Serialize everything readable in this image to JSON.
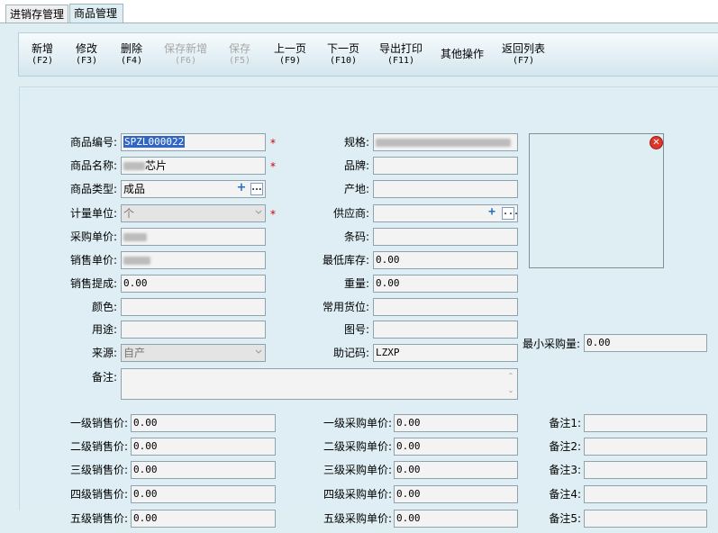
{
  "tabs": [
    {
      "label": "进销存管理"
    },
    {
      "label": "商品管理"
    }
  ],
  "toolbar": {
    "new": {
      "label": "新增",
      "key": "(F2)"
    },
    "edit": {
      "label": "修改",
      "key": "(F3)"
    },
    "delete": {
      "label": "删除",
      "key": "(F4)"
    },
    "save_new": {
      "label": "保存新增",
      "key": "(F6)"
    },
    "save": {
      "label": "保存",
      "key": "(F5)"
    },
    "prev": {
      "label": "上一页",
      "key": "(F9)"
    },
    "next": {
      "label": "下一页",
      "key": "(F10)"
    },
    "export": {
      "label": "导出打印",
      "key": "(F11)"
    },
    "other": {
      "label": "其他操作"
    },
    "back": {
      "label": "返回列表",
      "key": "(F7)"
    }
  },
  "form": {
    "code": {
      "label": "商品编号:",
      "value": "SPZL000022"
    },
    "name": {
      "label": "商品名称:",
      "value": "芯片"
    },
    "type": {
      "label": "商品类型:",
      "value": "成品"
    },
    "unit": {
      "label": "计量单位:",
      "value": "个"
    },
    "purchase_price": {
      "label": "采购单价:"
    },
    "sale_price": {
      "label": "销售单价:"
    },
    "commission": {
      "label": "销售提成:",
      "value": "0.00"
    },
    "color": {
      "label": "颜色:"
    },
    "usage": {
      "label": "用途:"
    },
    "source": {
      "label": "来源:",
      "value": "自产"
    },
    "remark": {
      "label": "备注:"
    },
    "spec": {
      "label": "规格:"
    },
    "brand": {
      "label": "品牌:"
    },
    "origin": {
      "label": "产地:"
    },
    "supplier": {
      "label": "供应商:"
    },
    "barcode": {
      "label": "条码:"
    },
    "min_stock": {
      "label": "最低库存:",
      "value": "0.00"
    },
    "weight": {
      "label": "重量:",
      "value": "0.00"
    },
    "location": {
      "label": "常用货位:"
    },
    "drawing": {
      "label": "图号:"
    },
    "mnemonic": {
      "label": "助记码:",
      "value": "LZXP"
    },
    "min_purchase": {
      "label": "最小采购量:",
      "value": "0.00"
    }
  },
  "levels": [
    {
      "sale_label": "一级销售价:",
      "sale": "0.00",
      "buy_label": "一级采购单价:",
      "buy": "0.00",
      "note_label": "备注1:"
    },
    {
      "sale_label": "二级销售价:",
      "sale": "0.00",
      "buy_label": "二级采购单价:",
      "buy": "0.00",
      "note_label": "备注2:"
    },
    {
      "sale_label": "三级销售价:",
      "sale": "0.00",
      "buy_label": "三级采购单价:",
      "buy": "0.00",
      "note_label": "备注3:"
    },
    {
      "sale_label": "四级销售价:",
      "sale": "0.00",
      "buy_label": "四级采购单价:",
      "buy": "0.00",
      "note_label": "备注4:"
    },
    {
      "sale_label": "五级销售价:",
      "sale": "0.00",
      "buy_label": "五级采购单价:",
      "buy": "0.00",
      "note_label": "备注5:"
    }
  ],
  "required_mark": "*",
  "icons": {
    "add": "plus-icon",
    "browse": "ellipsis-icon",
    "delete_photo": "delete-icon",
    "dropdown": "chevron-down-icon"
  },
  "colors": {
    "accent": "#3166c5",
    "required": "#d00000",
    "delete": "#e0342b"
  }
}
